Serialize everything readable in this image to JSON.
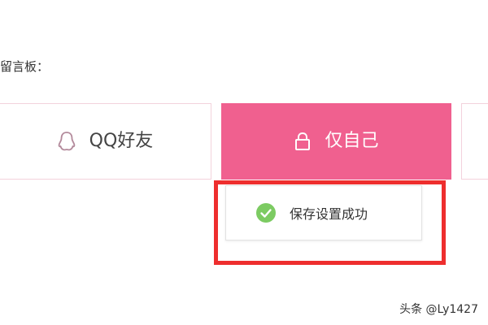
{
  "section_label": "留言板：",
  "options": {
    "qq_friends": {
      "label": "QQ好友",
      "icon": "qq-penguin-icon",
      "selected": false
    },
    "only_me": {
      "label": "仅自己",
      "icon": "lock-icon",
      "selected": true
    }
  },
  "toast": {
    "message": "保存设置成功",
    "icon": "check-circle-icon"
  },
  "watermark": "头条 @Ly1427",
  "colors": {
    "accent": "#f0608f",
    "option_border": "#f3d2dc",
    "success": "#7ccb62",
    "highlight": "#ee2e2e"
  }
}
